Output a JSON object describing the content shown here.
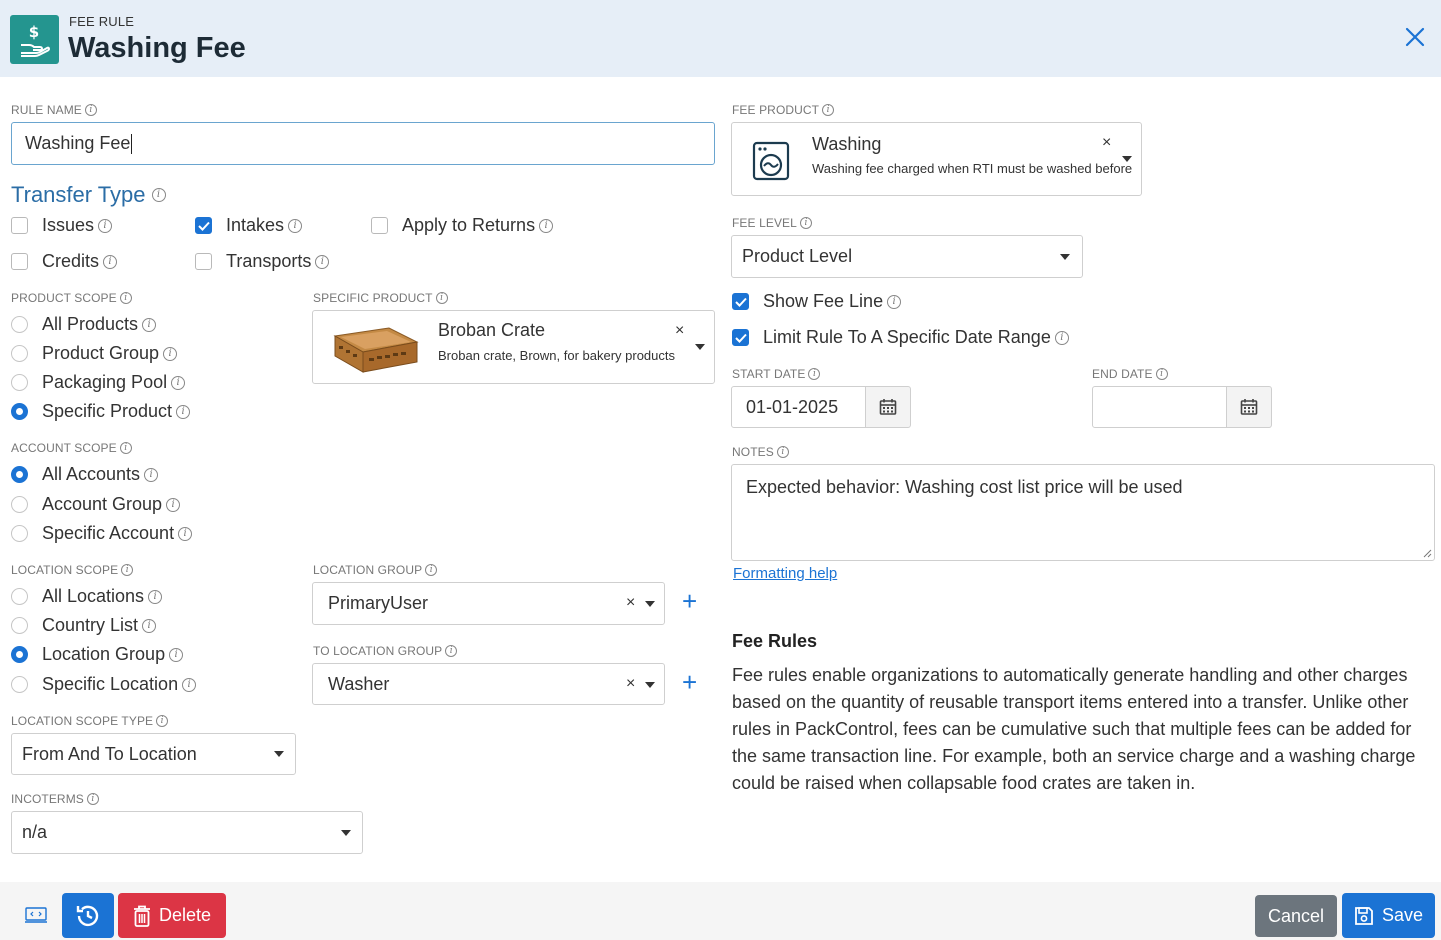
{
  "header": {
    "kind": "FEE RULE",
    "title": "Washing Fee",
    "icon": "hand-dollar-icon",
    "close": "close-icon"
  },
  "rule_name": {
    "label": "RULE NAME",
    "value": "Washing Fee"
  },
  "transfer_type": {
    "title": "Transfer Type",
    "options": [
      {
        "label": "Issues",
        "checked": false
      },
      {
        "label": "Intakes",
        "checked": true
      },
      {
        "label": "Apply to Returns",
        "checked": false
      },
      {
        "label": "Credits",
        "checked": false
      },
      {
        "label": "Transports",
        "checked": false
      }
    ]
  },
  "product_scope": {
    "label": "PRODUCT SCOPE",
    "options": [
      "All Products",
      "Product Group",
      "Packaging Pool",
      "Specific Product"
    ],
    "selected": "Specific Product"
  },
  "specific_product": {
    "label": "SPECIFIC PRODUCT",
    "name": "Broban Crate",
    "description": "Broban crate, Brown, for bakery products",
    "clear": "×"
  },
  "account_scope": {
    "label": "ACCOUNT SCOPE",
    "options": [
      "All Accounts",
      "Account Group",
      "Specific Account"
    ],
    "selected": "All Accounts"
  },
  "location_scope": {
    "label": "LOCATION SCOPE",
    "options": [
      "All Locations",
      "Country List",
      "Location Group",
      "Specific Location"
    ],
    "selected": "Location Group"
  },
  "location_group": {
    "label": "LOCATION GROUP",
    "value": "PrimaryUser",
    "clear": "×",
    "add": "+"
  },
  "to_location_group": {
    "label": "TO LOCATION GROUP",
    "value": "Washer",
    "clear": "×",
    "add": "+"
  },
  "location_scope_type": {
    "label": "LOCATION SCOPE TYPE",
    "value": "From And To Location"
  },
  "incoterms": {
    "label": "INCOTERMS",
    "value": "n/a"
  },
  "fee_product": {
    "label": "FEE PRODUCT",
    "name": "Washing",
    "description": "Washing fee charged when RTI must be washed before",
    "clear": "×",
    "icon": "washing-machine-icon"
  },
  "fee_level": {
    "label": "FEE LEVEL",
    "value": "Product Level"
  },
  "show_fee_line": {
    "label": "Show Fee Line",
    "checked": true
  },
  "limit_date_range": {
    "label": "Limit Rule To A Specific Date Range",
    "checked": true
  },
  "start_date": {
    "label": "START DATE",
    "value": "01-01-2025"
  },
  "end_date": {
    "label": "END DATE",
    "value": ""
  },
  "notes": {
    "label": "NOTES",
    "value": "Expected behavior: Washing cost list price will be used",
    "formatting_help": "Formatting help"
  },
  "help": {
    "title": "Fee Rules",
    "lines": [
      "Fee rules enable organizations to automatically generate handling and other charges",
      "based on the quantity of reusable transport items entered into a transfer. Unlike other",
      "rules in PackControl, fees can be cumulative such that multiple fees can be added for",
      "the same transaction line. For example, both an service charge and a washing charge",
      "could be raised when collapsable food crates are taken in."
    ]
  },
  "footer": {
    "delete": "Delete",
    "cancel": "Cancel",
    "save": "Save"
  },
  "colors": {
    "accent": "#1b73d4",
    "teal": "#24958f",
    "danger": "#dc3545",
    "secondary": "#6c757d",
    "header_bg": "#e6eef7"
  }
}
